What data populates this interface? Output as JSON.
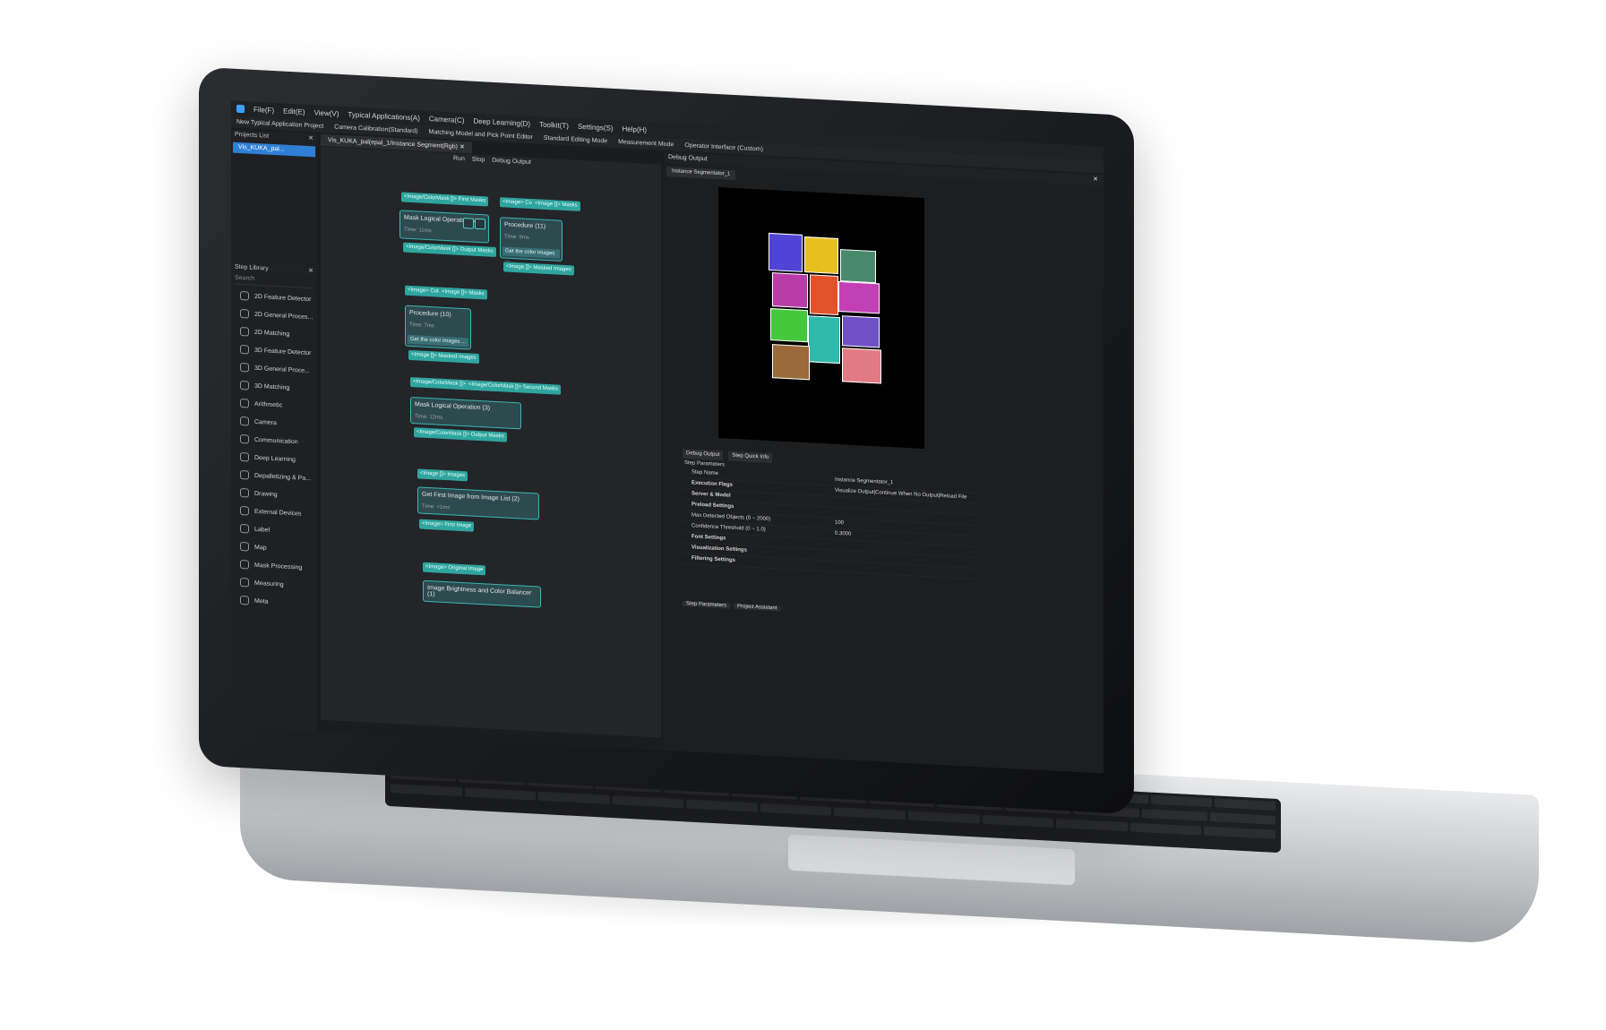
{
  "menu": [
    "File(F)",
    "Edit(E)",
    "View(V)",
    "Typical Applications(A)",
    "Camera(C)",
    "Deep Learning(D)",
    "Toolkit(T)",
    "Settings(S)",
    "Help(H)"
  ],
  "toolbar": [
    "New Typical Application Project",
    "Camera Calibration(Standard)",
    "Matching Model and Pick Point Editor",
    "Standard Editing Mode",
    "Measurement Mode",
    "Operator Interface (Custom)"
  ],
  "projects": {
    "title": "Projects List",
    "item": "Vis_KUKA_pal..."
  },
  "tab": {
    "label": "Vis_KUKA_pal(epal_1/Instance Segment(Rgb)"
  },
  "run": {
    "run": "Run",
    "stop": "Stop",
    "debug": "Debug Output"
  },
  "steplib": {
    "title": "Step Library",
    "search": "Search",
    "items": [
      "2D Feature Detector",
      "2D General Proces...",
      "2D Matching",
      "3D Feature Detector",
      "3D General Proce...",
      "3D Matching",
      "Arithmetic",
      "Camera",
      "Communication",
      "Deep Learning",
      "Depalletizing & Pa...",
      "Drawing",
      "External Devices",
      "Label",
      "Map",
      "Mask Processing",
      "Measuring",
      "Meta"
    ]
  },
  "nodes": {
    "n1": {
      "in": "<Image/ColorMask []>\nFirst Masks",
      "title": "Mask Logical Operation (4)",
      "time": "Time: 11ms",
      "out": "<Image/ColorMask []>\nOutput Masks"
    },
    "n2": {
      "in1": "<Image>\nColor Image",
      "in2": "<Image []>\nMasks",
      "title": "Procedure (11)",
      "time": "Time: 9ms",
      "desc": "Get the color images ...",
      "out": "<Image []>\nMasked Images"
    },
    "n3": {
      "in1": "<Image>\nColor Image",
      "in2": "<Image []>\nMasks",
      "title": "Procedure (10)",
      "time": "Time: 7ms",
      "desc": "Get the color images ...",
      "out": "<Image []>\nMasked Images"
    },
    "n4": {
      "in1": "<Image/ColorMask []>\nFirst Masks",
      "in2": "<Image/ColorMask []>\nSecond Masks",
      "title": "Mask Logical Operation (3)",
      "time": "Time: 12ms",
      "out": "<Image/ColorMask []>\nOutput Masks"
    },
    "n5": {
      "in": "<Image []>\nImages",
      "title": "Get First Image from Image List (2)",
      "time": "Time: <1ms",
      "out": "<Image>\nFirst Image"
    },
    "n6": {
      "in": "<Image>\nOriginal Image",
      "title": "Image Brightness and Color Balancer (1)"
    }
  },
  "debug": {
    "title": "Debug Output",
    "tab": "Instance Segmentator_1"
  },
  "params": {
    "tabs": [
      "Debug Output",
      "Step Quick Info"
    ],
    "header": "Step Parameters",
    "rows": [
      {
        "k": "Step Name",
        "v": "Instance Segmentator_1",
        "b": false
      },
      {
        "k": "Execution Flags",
        "v": "Visualize Output|Continue When No Output|Reload File",
        "b": true
      },
      {
        "k": "Server & Model",
        "v": "",
        "b": true
      },
      {
        "k": "Preload Settings",
        "v": "",
        "b": true
      },
      {
        "k": "Max Detected Objects (0 ~ 2000)",
        "v": "100",
        "b": false
      },
      {
        "k": "Confidence Threshold (0 ~ 1.0)",
        "v": "0.3000",
        "b": false
      },
      {
        "k": "Font Settings",
        "v": "",
        "b": true
      },
      {
        "k": "Visualization Settings",
        "v": "",
        "b": true
      },
      {
        "k": "Filtering Settings",
        "v": "",
        "b": true
      }
    ],
    "bottom_tabs": [
      "Step Parameters",
      "Project Assistant"
    ]
  },
  "colors": {
    "accent": "#37b9b3",
    "selection": "#2f7fd6"
  }
}
